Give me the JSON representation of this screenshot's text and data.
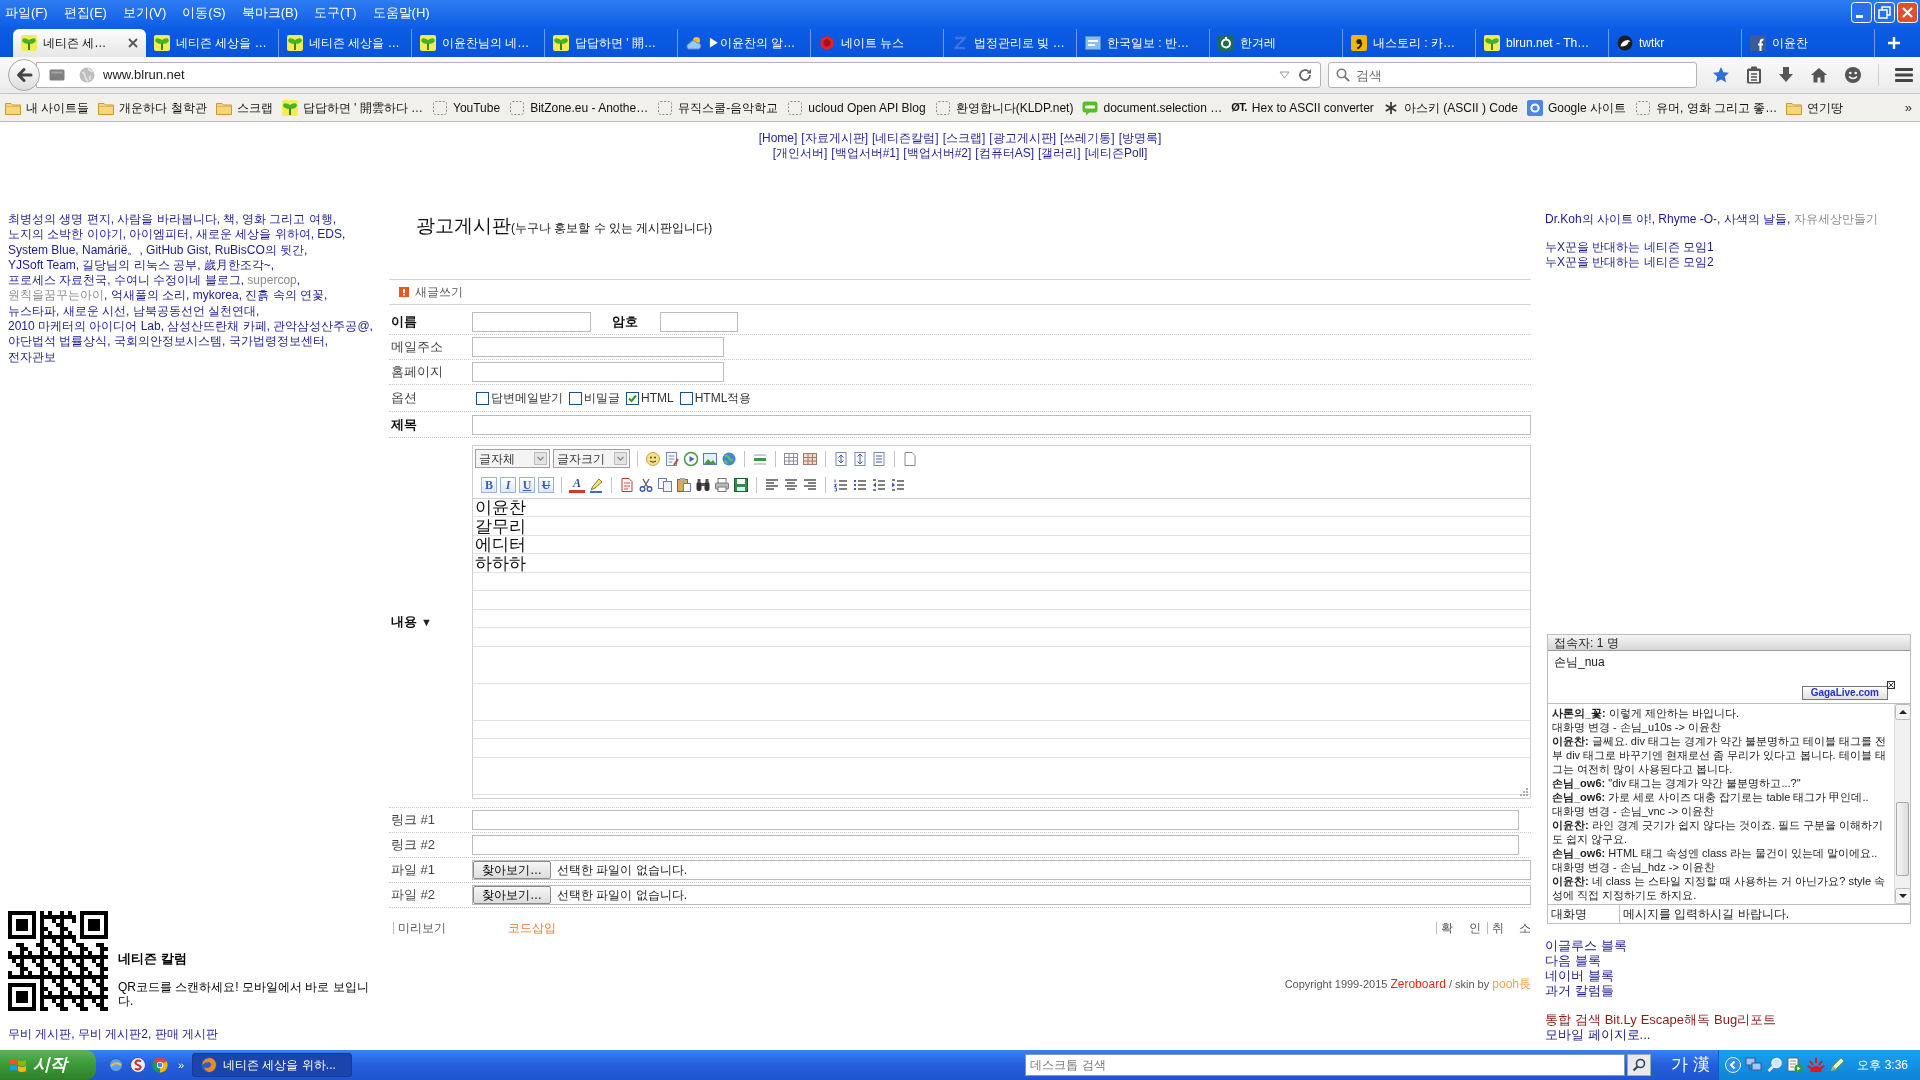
{
  "menu_bar": [
    "파일(F)",
    "편집(E)",
    "보기(V)",
    "이동(S)",
    "북마크(B)",
    "도구(T)",
    "도움말(H)"
  ],
  "tabs": [
    {
      "title": "네티즌 세…",
      "kind": "sprout",
      "selected": true
    },
    {
      "title": "네티즌 세상을 …",
      "kind": "sprout",
      "selected": false
    },
    {
      "title": "네티즌 세상을 …",
      "kind": "sprout",
      "selected": false
    },
    {
      "title": "이윤찬님의 네…",
      "kind": "sprout",
      "selected": false
    },
    {
      "title": "답답하면 ' 開…",
      "kind": "sprout",
      "selected": false
    },
    {
      "title": "▶이윤찬의 알…",
      "kind": "weather",
      "selected": false
    },
    {
      "title": "네이트 뉴스",
      "kind": "gem",
      "selected": false
    },
    {
      "title": "법정관리로 빚 …",
      "kind": "zigzag",
      "selected": false
    },
    {
      "title": "한국일보 : 반…",
      "kind": "tile",
      "selected": false
    },
    {
      "title": "한겨레",
      "kind": "ring",
      "selected": false
    },
    {
      "title": "내스토리 : 카…",
      "kind": "comma",
      "selected": false
    },
    {
      "title": "blrun.net - Th…",
      "kind": "sprout",
      "selected": false
    },
    {
      "title": "twtkr",
      "kind": "bird",
      "selected": false
    },
    {
      "title": "이윤찬",
      "kind": "letter",
      "selected": false
    }
  ],
  "address_bar": {
    "url": "www.blrun.net"
  },
  "search_bar": {
    "placeholder": "검색"
  },
  "bookmarks": {
    "items": [
      {
        "label": "내 사이트들",
        "kind": "folder"
      },
      {
        "label": "개운하다 철학관",
        "kind": "folder"
      },
      {
        "label": "스크랩",
        "kind": "folder"
      },
      {
        "label": "답답하면 ' 開雲하다 …",
        "kind": "sprout"
      },
      {
        "label": "YouTube",
        "kind": "page"
      },
      {
        "label": "BitZone.eu - Anothe…",
        "kind": "page"
      },
      {
        "label": "뮤직스쿨-음악학교",
        "kind": "page"
      },
      {
        "label": "ucloud Open API Blog",
        "kind": "page"
      },
      {
        "label": "환영합니다(KLDP.net)",
        "kind": "page"
      },
      {
        "label": "document.selection …",
        "kind": "blog"
      },
      {
        "label": "Hex to ASCII converter",
        "kind": "badge",
        "badge": "ØT."
      },
      {
        "label": "아스키 (ASCII ) Code",
        "kind": "asterisk"
      },
      {
        "label": "Google 사이트",
        "kind": "square"
      },
      {
        "label": "유머, 영화 그리고 좋…",
        "kind": "page"
      },
      {
        "label": "연기땅",
        "kind": "folder"
      }
    ],
    "overflow": "»"
  },
  "top_nav": [
    [
      "[Home]",
      "[자료게시판]",
      "[네티즌칼럼]",
      "[스크랩]",
      "[광고게시판]",
      "[쓰레기통]",
      "[방명록]"
    ],
    [
      "[개인서버]",
      "[백업서버#1]",
      "[백업서버#2]",
      "[컴퓨터AS]",
      "[갤러리]",
      "[네티즌Poll]"
    ]
  ],
  "left_links": {
    "separator": ",",
    "items": [
      {
        "label": "최병성의 생명 편지",
        "muted": false
      },
      {
        "label": "사람을 바라봅니다",
        "muted": false
      },
      {
        "label": "책, 영화 그리고 여행",
        "muted": false
      },
      {
        "label": "노지의 소박한 이야기",
        "muted": false
      },
      {
        "label": "아이엠피터",
        "muted": false
      },
      {
        "label": "새로운 세상을 위하여",
        "muted": false
      },
      {
        "label": "EDS",
        "muted": false
      },
      {
        "label": "System Blue",
        "muted": false
      },
      {
        "label": "Namárië。",
        "muted": false
      },
      {
        "label": "GitHub Gist",
        "muted": false
      },
      {
        "label": "RuBisCO의 뒷간",
        "muted": false
      },
      {
        "label": "YJSoft Team",
        "muted": false
      },
      {
        "label": "길당님의 리눅스 공부",
        "muted": false
      },
      {
        "label": "歲月한조각~",
        "muted": false
      },
      {
        "label": "프로세스 자료천국",
        "muted": false
      },
      {
        "label": "수여니 수정이네 블로그",
        "muted": false
      },
      {
        "label": "supercop",
        "muted": true
      },
      {
        "label": "원칙을꿈꾸는아이",
        "muted": true
      },
      {
        "label": "억새풀의 소리",
        "muted": false
      },
      {
        "label": "mykorea",
        "muted": false
      },
      {
        "label": "진흙 속의 연꽃",
        "muted": false
      },
      {
        "label": "뉴스타파",
        "muted": false
      },
      {
        "label": "새로운 시선",
        "muted": false
      },
      {
        "label": "남북공동선언 실천연대",
        "muted": false
      },
      {
        "label": "2010 마케터의 아이디어 Lab",
        "muted": false
      },
      {
        "label": "삼성산뜨란채 카페",
        "muted": false
      },
      {
        "label": "관악삼성산주공@",
        "muted": false
      },
      {
        "label": "야단법석 법률상식",
        "muted": false
      },
      {
        "label": "국회의안정보시스템",
        "muted": false
      },
      {
        "label": "국가법령정보센터",
        "muted": false
      },
      {
        "label": "전자관보",
        "muted": false
      }
    ]
  },
  "qr_block": {
    "title": "네티즌 칼럼",
    "text": "QR코드를 스캔하세요! 모바일에서 바로 보입니다."
  },
  "board_links": {
    "separator": ",",
    "items": [
      "무비 게시판",
      "무비 게시판2",
      "판매 게시판"
    ]
  },
  "board": {
    "title": "광고게시판",
    "subtitle": "(누구나 홍보할 수 있는 게시판입니다)",
    "section": "새글쓰기",
    "name": {
      "label": "이름",
      "required": true
    },
    "password": {
      "label": "암호",
      "required": true
    },
    "email": {
      "label": "메일주소",
      "required": false
    },
    "homepage": {
      "label": "홈페이지",
      "required": false
    },
    "options": {
      "label": "옵션",
      "items": [
        {
          "label": "답변메일받기",
          "checked": false
        },
        {
          "label": "비밀글",
          "checked": false
        },
        {
          "label": "HTML",
          "checked": true
        },
        {
          "label": "HTML적용",
          "checked": false
        }
      ]
    },
    "subject": {
      "label": "제목",
      "required": true
    },
    "content": {
      "label": "내용",
      "required": true,
      "toggle": "▼",
      "font_select": "글자체",
      "size_select": "글자크기",
      "format_buttons": [
        "B",
        "I",
        "U",
        "U"
      ],
      "color_button": "A",
      "lines": [
        "이윤찬",
        "갈무리",
        "에디터",
        "하하하"
      ]
    },
    "links": [
      {
        "label": "링크 #1"
      },
      {
        "label": "링크 #2"
      }
    ],
    "files": [
      {
        "label": "파일 #1",
        "button": "찾아보기…",
        "status": "선택한 파일이 없습니다."
      },
      {
        "label": "파일 #2",
        "button": "찾아보기…",
        "status": "선택한 파일이 없습니다."
      }
    ],
    "actions": {
      "preview": "미리보기",
      "insert_code": "코드삽입",
      "confirm": "확 인",
      "cancel": "취 소"
    },
    "copyright": [
      {
        "text": "Copyright 1999-2015",
        "kind": "plain"
      },
      {
        "text": "Zeroboard",
        "kind": "link",
        "color": "#e8261f"
      },
      {
        "text": "/ skin by",
        "kind": "plain"
      },
      {
        "text": "pooh長",
        "kind": "link",
        "color": "#f4a14d"
      }
    ]
  },
  "right_links": {
    "separator": ",",
    "items": [
      {
        "label": "Dr.Koh의 사이트 야!",
        "muted": false
      },
      {
        "label": "Rhyme -O-",
        "muted": false
      },
      {
        "label": "사색의 날들",
        "muted": false
      },
      {
        "label": "자유세상만들기",
        "muted": true
      }
    ]
  },
  "group_links": [
    "누X꾼을 반대하는 네티즌 모임1",
    "누X꾼을 반대하는 네티즌 모임2"
  ],
  "chat": {
    "header": "접속자: 1 명",
    "users": [
      "손님_nua"
    ],
    "brand_button": "GagaLive.com",
    "messages": [
      "**사론의_꽃:** 이렇게 제안하는 바입니다.",
      "대화명 변경 - 손님_u10s -> 이윤찬",
      "**이윤찬:** 글쎄요. div 태그는 경계가 약간 불분명하고 테이블 태그를 전부 div 태그로 바꾸기엔 현재로선 좀 무리가 있다고 봅니다. 테이블 태그는 여전히 많이 사용된다고 봅니다.",
      "**손님_ow6:** \"div 태그는 경계가 약간 불분명하고...?\"",
      "**손님_ow6:** 가로 세로 사이즈 대충 잡기로는 table 태그가 甲인데..",
      "대화명 변경 - 손님_vnc -> 이윤찬",
      "**이윤찬:** 라인 경계 긋기가 쉽지 않다는 것이죠. 필드 구분을 이해하기도 쉽지 않구요.",
      "**손님_ow6:** HTML 태그 속성엔 class 라는 물건이 있는데 말이에요..",
      "대화명 변경 - 손님_hdz -> 이윤찬",
      "**이윤찬:** 네 class 는 스타일 지정할 때 사용하는 거 아닌가요? style 속성에 직접 지정하기도 하지요."
    ],
    "name_field": {
      "placeholder": "대화명"
    },
    "message_field": {
      "placeholder": "메시지를 입력하시길 바랍니다."
    }
  },
  "blog_links": [
    "이글루스 블록",
    "다음 블록",
    "네이버 블록",
    "과거 칼럼들"
  ],
  "tool_links": [
    "통합 검색",
    "Bit.Ly",
    "Escape해독",
    "Bug리포트"
  ],
  "mobile_link": "모바일 페이지로...",
  "taskbar": {
    "start": "시작",
    "overflow": "»",
    "tasks": [
      {
        "label": "네티즌 세상을 위하...",
        "selected": true
      }
    ],
    "search": {
      "placeholder": "데스크톱 검색"
    },
    "ime": [
      "가",
      "漢"
    ],
    "clock": "오후 3:36"
  }
}
